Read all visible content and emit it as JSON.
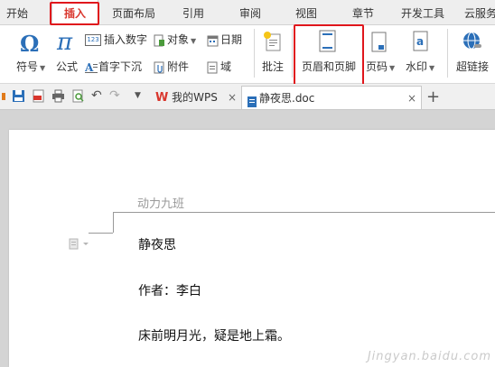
{
  "menu": {
    "tabs": [
      {
        "label": "开始"
      },
      {
        "label": "插入"
      },
      {
        "label": "页面布局"
      },
      {
        "label": "引用"
      },
      {
        "label": "审阅"
      },
      {
        "label": "视图"
      },
      {
        "label": "章节"
      },
      {
        "label": "开发工具"
      },
      {
        "label": "云服务"
      }
    ],
    "active_index": 1
  },
  "ribbon": {
    "symbol": "符号",
    "formula": "公式",
    "insert_number": "插入数字",
    "object": "对象",
    "date": "日期",
    "drop_cap": "首字下沉",
    "attachment": "附件",
    "field": "域",
    "comment": "批注",
    "header_footer": "页眉和页脚",
    "page_number": "页码",
    "watermark": "水印",
    "hyperlink": "超链接",
    "number_badge": "123"
  },
  "quickbar": {
    "tabs": [
      {
        "label": "我的WPS"
      },
      {
        "label": "静夜思.doc"
      }
    ],
    "close_glyph": "×",
    "new_tab_glyph": "+"
  },
  "document": {
    "header_text": "动力九班",
    "lines": [
      "静夜思",
      "作者：李白",
      "床前明月光，疑是地上霜。"
    ]
  },
  "watermark_text": "Jingyan.baidu.com",
  "colors": {
    "accent_red": "#e0161c",
    "active_tab_text": "#d9362d",
    "icon_blue": "#2b6fb8"
  }
}
